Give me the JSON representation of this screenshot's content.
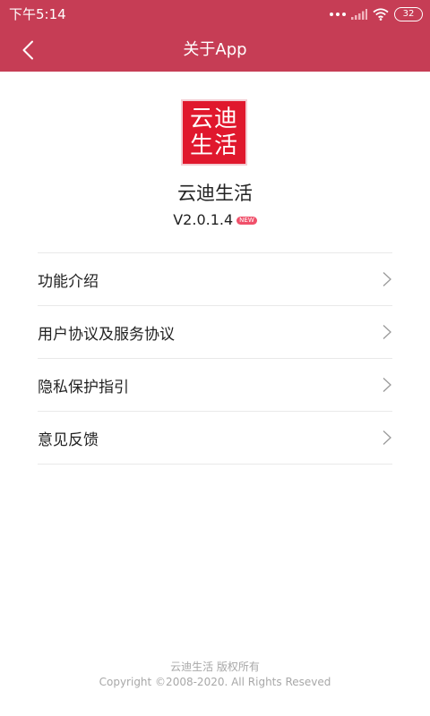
{
  "status_bar": {
    "time": "下午5:14",
    "battery": "32",
    "icons": [
      "dots-icon",
      "signal-icon",
      "wifi-icon",
      "battery-icon"
    ]
  },
  "header": {
    "title": "关于App",
    "back_icon": "back-arrow-icon"
  },
  "app": {
    "logo_line1": "云迪",
    "logo_line2": "生活",
    "name": "云迪生活",
    "version": "V2.0.1.4",
    "badge": "NEW"
  },
  "menu": {
    "items": [
      {
        "label": "功能介绍"
      },
      {
        "label": "用户协议及服务协议"
      },
      {
        "label": "隐私保护指引"
      },
      {
        "label": "意见反馈"
      }
    ]
  },
  "footer": {
    "line1": "云迪生活 版权所有",
    "line2": "Copyright ©2008-2020. All Rights Reseved"
  },
  "colors": {
    "header_bg": "#c63d55",
    "logo_bg": "#e0182d",
    "badge_bg": "#f0506a"
  }
}
